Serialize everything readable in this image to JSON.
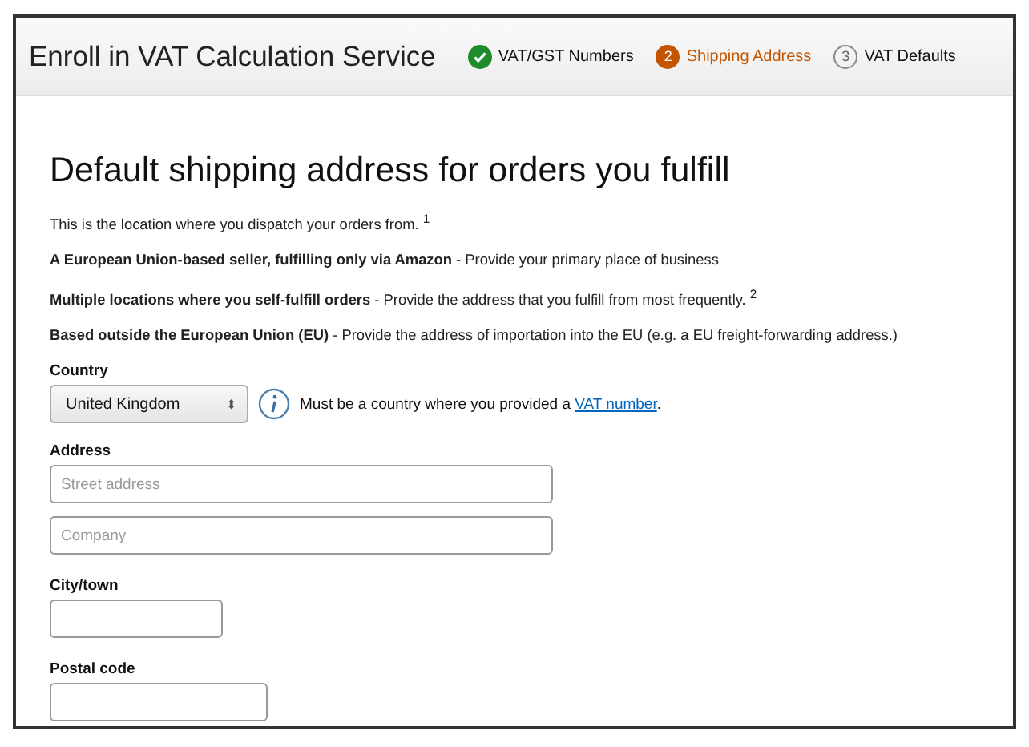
{
  "header": {
    "title": "Enroll in VAT Calculation Service",
    "steps": [
      {
        "label": "VAT/GST Numbers",
        "completed": true,
        "selected": false
      },
      {
        "label": "Shipping Address",
        "completed": false,
        "selected": true,
        "number": "2"
      },
      {
        "label": "VAT Defaults",
        "completed": false,
        "selected": false,
        "number": "3"
      }
    ]
  },
  "heading": "Default shipping address for orders you fulfill",
  "paragraphs": [
    "This is the location where you dispatch your orders from. $^{1}$",
    "**A European Union-based seller, fulfilling only via Amazon** - Provide your primary place of business",
    "**Multiple locations where you self-fulfill orders** - Provide the address that you fulfill from most frequently. $^{2}$",
    "**Based outside the European Union (EU)** - Provide the address of importation into the EU (e.g. a EU freight-forwarding address.)"
  ],
  "country": {
    "label": "Country",
    "value": "United Kingdom",
    "arrows": "⬍",
    "hint": "Must be a country where you provided a",
    "link": "VAT number",
    "hint_end": "."
  },
  "address": {
    "label": "Address",
    "fields": [
      {
        "placeholder": "Street address"
      },
      {
        "placeholder": "Company"
      }
    ]
  },
  "city": {
    "label": "City/town"
  },
  "postal": {
    "label": "Postal code"
  }
}
